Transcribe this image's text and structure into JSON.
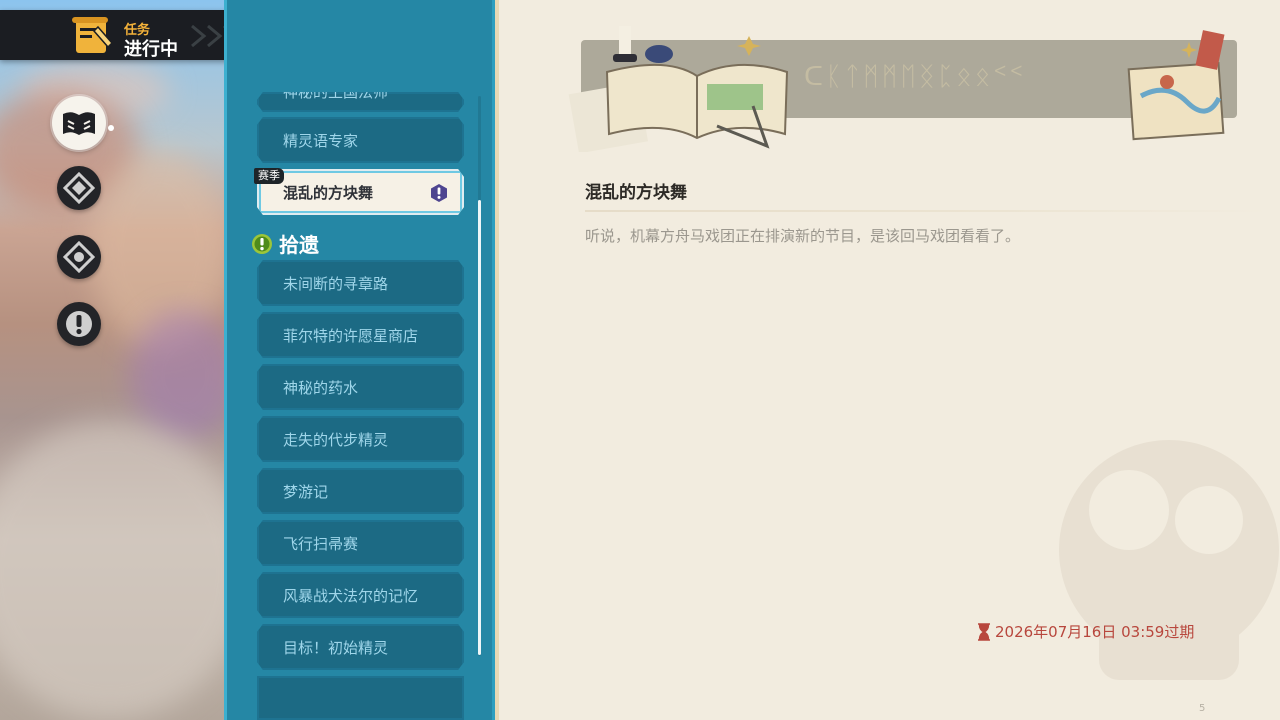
{
  "header": {
    "small_label": "任务",
    "big_label": "进行中"
  },
  "side_categories": [
    {
      "name": "book",
      "active": true
    },
    {
      "name": "compass-1",
      "active": false
    },
    {
      "name": "compass-2",
      "active": false
    },
    {
      "name": "exclamation",
      "active": false
    }
  ],
  "quest_list": {
    "partial_top": "神秘的王国法师",
    "items_before": [
      "精灵语专家"
    ],
    "selected": {
      "badge": "赛季",
      "label": "混乱的方块舞"
    },
    "section_label": "拾遗",
    "items_after": [
      "未间断的寻章路",
      "菲尔特的许愿星商店",
      "神秘的药水",
      "走失的代步精灵",
      "梦游记",
      "飞行扫帚赛",
      "风暴战犬法尔的记忆",
      "目标！初始精灵"
    ]
  },
  "detail": {
    "banner_runes": "ᑕᛕᛏᛗᛗᛖᛝᛈᛟᛟᑉᑉ",
    "title": "混乱的方块舞",
    "description": "听说，机幕方舟马戏团正在排演新的节目，是该回马戏团看看了。",
    "expire_text": "2026年07月16日 03:59过期",
    "corner_number": "5"
  },
  "colors": {
    "list_bg": "#2587a5",
    "item_bg": "#1c6a84",
    "item_text": "#9fd6ea",
    "selected_bg": "#f6f1e6",
    "expire_red": "#b8473d",
    "paper": "#f2ecdf"
  }
}
